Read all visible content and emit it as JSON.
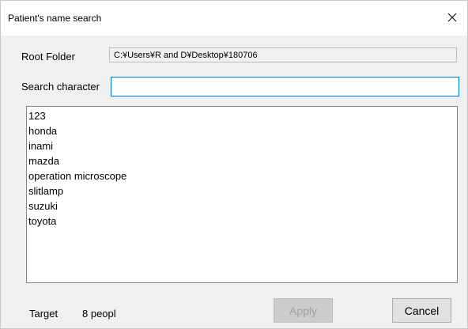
{
  "window": {
    "title": "Patient's name search"
  },
  "form": {
    "root_folder_label": "Root Folder",
    "root_folder_value": "C:¥Users¥R and D¥Desktop¥180706",
    "search_label": "Search character",
    "search_value": "",
    "search_placeholder": ""
  },
  "results": {
    "items": [
      "123",
      "honda",
      "inami",
      "mazda",
      "operation microscope",
      "slitlamp",
      "suzuki",
      "toyota"
    ]
  },
  "footer": {
    "target_label": "Target",
    "target_count": "8 peopl",
    "apply_label": "Apply",
    "cancel_label": "Cancel"
  },
  "icons": {
    "close": "close-icon"
  }
}
